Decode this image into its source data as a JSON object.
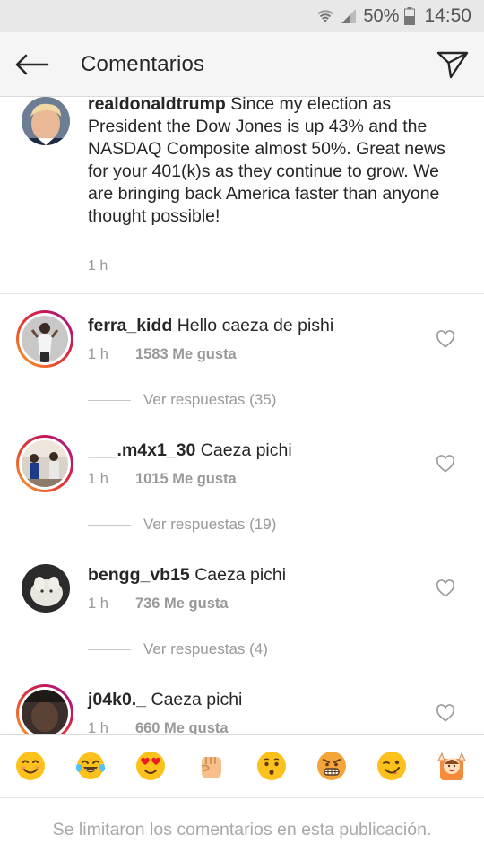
{
  "status_bar": {
    "battery": "50%",
    "time": "14:50"
  },
  "header": {
    "title": "Comentarios"
  },
  "caption": {
    "username": "realdonaldtrump",
    "text": "Since my election as President the Dow Jones is up 43% and the NASDAQ Composite almost 50%. Great news for your 401(k)s as they continue to grow. We are bringing back America faster than anyone thought possible!",
    "time": "1 h"
  },
  "comments": [
    {
      "username": "ferra_kidd",
      "text": "Hello caeza de pishi",
      "time": "1 h",
      "likes": "1583 Me gusta",
      "replies": "Ver respuestas (35)"
    },
    {
      "username": "___.m4x1_30",
      "text": "Caeza pichi",
      "time": "1 h",
      "likes": "1015 Me gusta",
      "replies": "Ver respuestas (19)"
    },
    {
      "username": "bengg_vb15",
      "text": "Caeza pichi",
      "time": "1 h",
      "likes": "736 Me gusta",
      "replies": "Ver respuestas (4)"
    },
    {
      "username": "j04k0._",
      "text": "Caeza pichi",
      "time": "1 h",
      "likes": "660 Me gusta"
    }
  ],
  "emojis": [
    "smiling-face",
    "tears-of-joy-face",
    "heart-eyes-face",
    "raised-fist",
    "flushed-face",
    "grimacing-angry-face",
    "winking-face",
    "raising-hands-face"
  ],
  "footer": {
    "notice": "Se limitaron los comentarios en esta publicación."
  },
  "colors": {
    "story_ring_start": "#f9a825",
    "story_ring_end": "#8e24aa",
    "secondary_text": "#999999"
  }
}
